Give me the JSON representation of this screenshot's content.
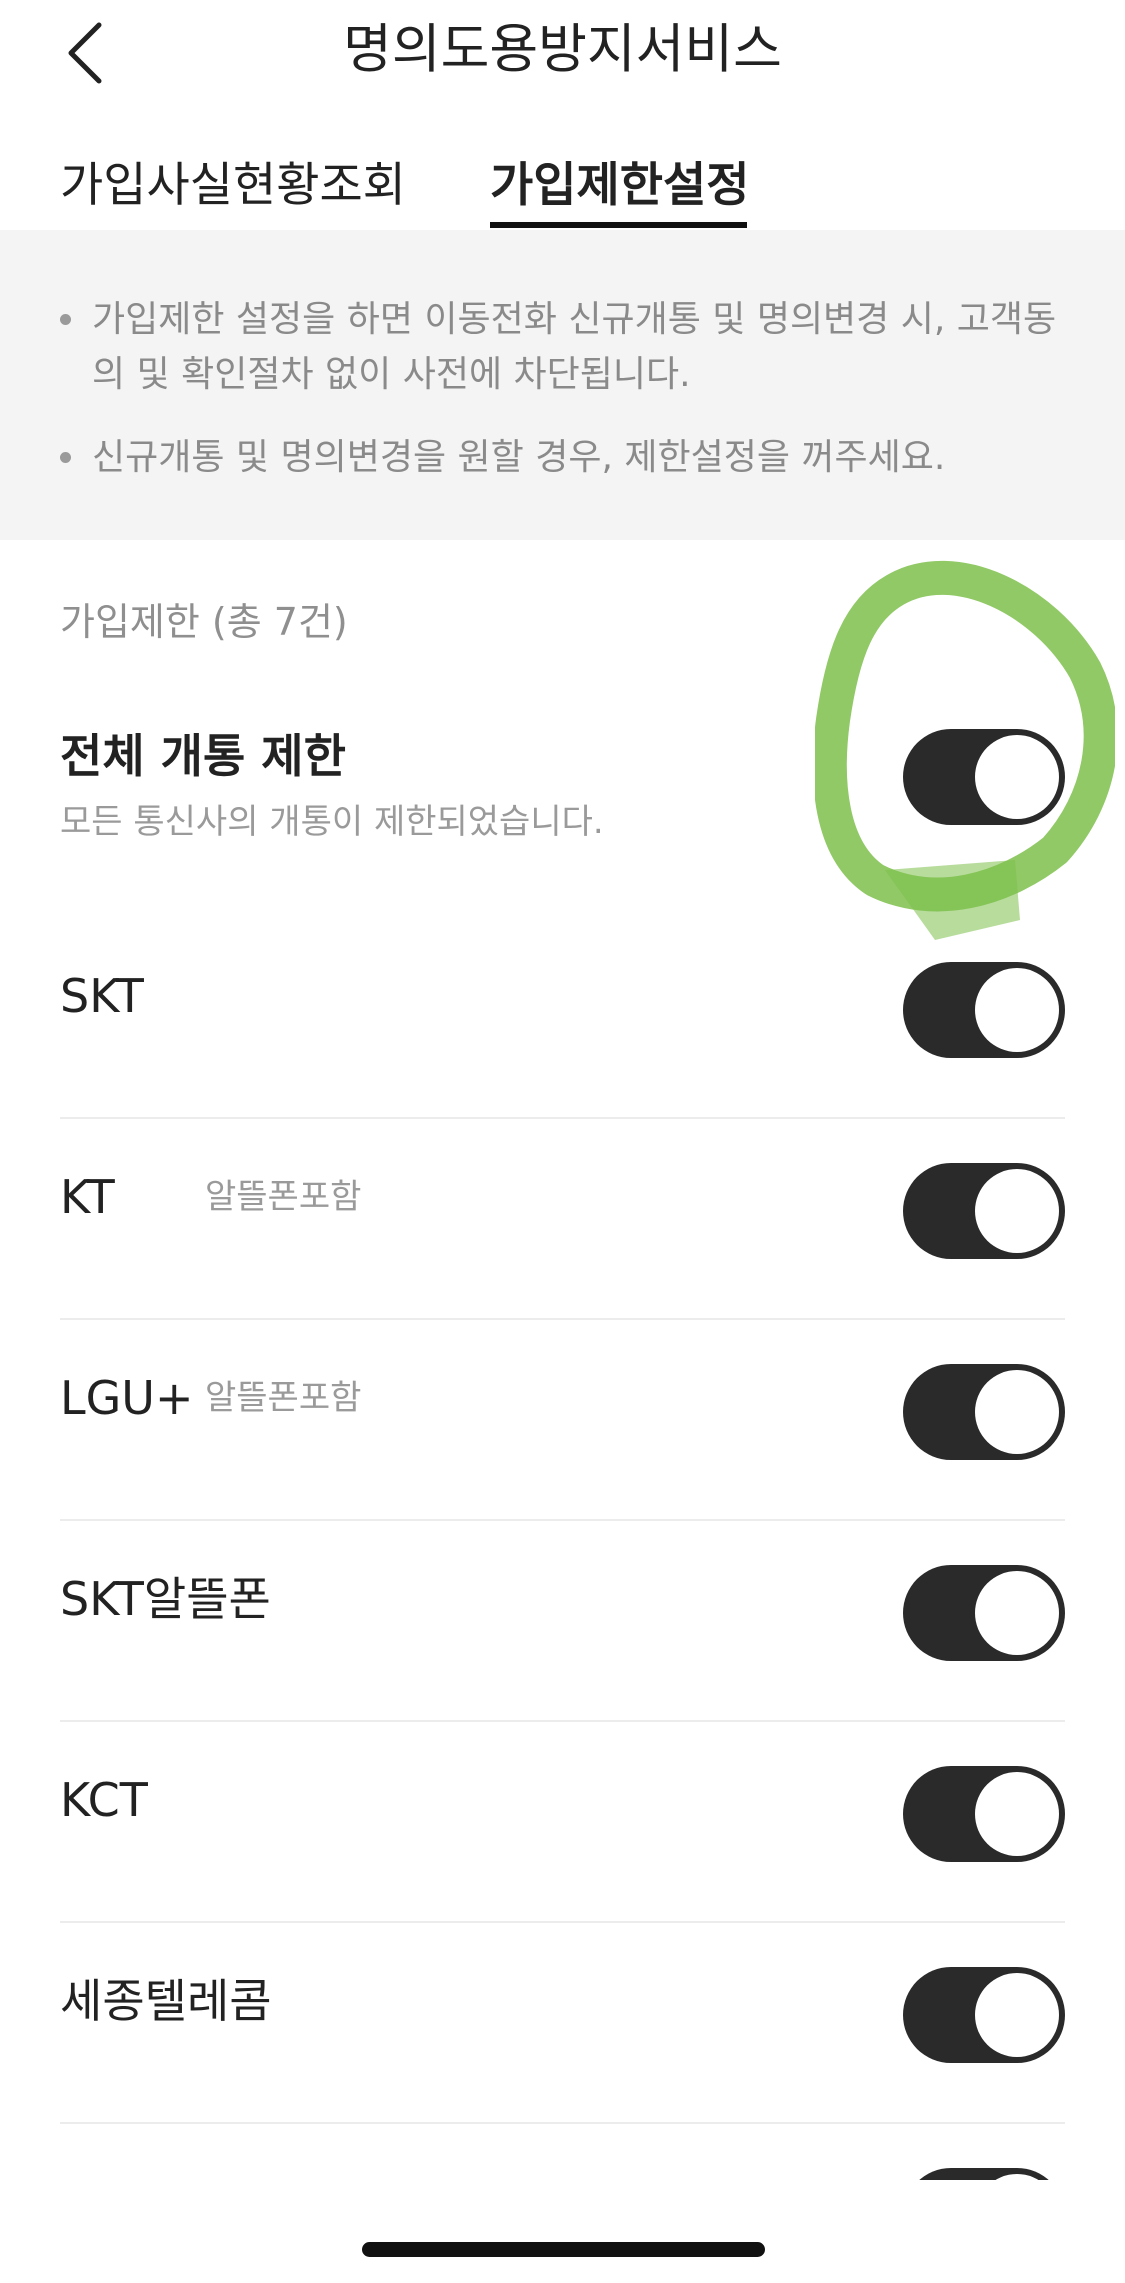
{
  "header": {
    "title": "명의도용방지서비스",
    "back_icon": "chevron-left-icon"
  },
  "tabs": [
    {
      "label": "가입사실현황조회",
      "active": false
    },
    {
      "label": "가입제한설정",
      "active": true
    }
  ],
  "info": {
    "items": [
      "가입제한 설정을 하면 이동전화 신규개통 및 명의변경 시, 고객동의 및 확인절차 없이 사전에 차단됩니다.",
      "신규개통 및 명의변경을 원할 경우, 제한설정을 꺼주세요."
    ]
  },
  "restriction": {
    "section_label": "가입제한 (총 7건)",
    "all": {
      "title": "전체 개통 제한",
      "subtitle": "모든 통신사의 개통이 제한되었습니다.",
      "enabled": true
    },
    "carriers": [
      {
        "name": "SKT",
        "tag": "",
        "enabled": true
      },
      {
        "name": "KT",
        "tag": "알뜰폰포함",
        "enabled": true
      },
      {
        "name": "LGU+",
        "tag": "알뜰폰포함",
        "enabled": true
      },
      {
        "name": "SKT알뜰폰",
        "tag": "",
        "enabled": true
      },
      {
        "name": "KCT",
        "tag": "",
        "enabled": true
      },
      {
        "name": "세종텔레콤",
        "tag": "",
        "enabled": true
      }
    ]
  },
  "colors": {
    "toggle_on": "#2a2a2a",
    "info_bg": "#f4f4f4",
    "highlight_marker": "#7cbf4a"
  }
}
